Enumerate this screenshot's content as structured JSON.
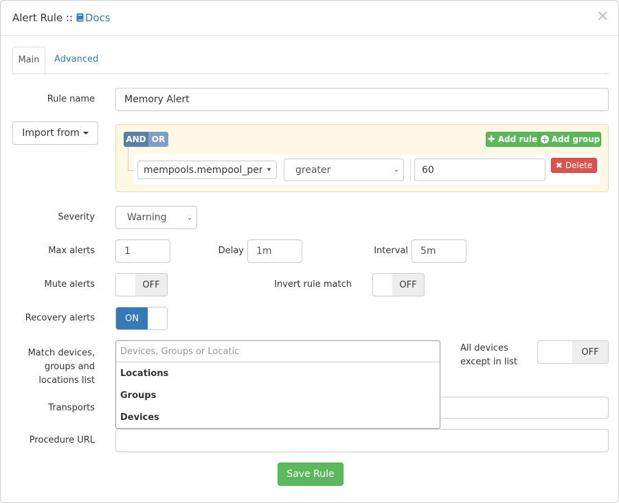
{
  "header": {
    "title": "Alert Rule ::",
    "docs_label": "Docs",
    "close_glyph": "×"
  },
  "tabs": [
    {
      "label": "Main",
      "active": true
    },
    {
      "label": "Advanced",
      "active": false
    }
  ],
  "rule_name": {
    "label": "Rule name",
    "value": "Memory Alert"
  },
  "import_from": {
    "label": "Import from"
  },
  "query_builder": {
    "and_label": "AND",
    "or_label": "OR",
    "selected_condition": "AND",
    "add_rule_label": "Add rule",
    "add_group_label": "Add group",
    "rule": {
      "field": "mempools.mempool_perc",
      "operator": "greater",
      "value": "60",
      "delete_label": "Delete"
    }
  },
  "severity": {
    "label": "Severity",
    "value": "Warning"
  },
  "max_alerts": {
    "label": "Max alerts",
    "value": "1"
  },
  "delay": {
    "label": "Delay",
    "value": "1m"
  },
  "interval": {
    "label": "Interval",
    "value": "5m"
  },
  "mute_alerts": {
    "label": "Mute alerts",
    "state": "OFF"
  },
  "invert_rule_match": {
    "label": "Invert rule match",
    "state": "OFF"
  },
  "recovery_alerts": {
    "label": "Recovery alerts",
    "state": "ON"
  },
  "match_devices": {
    "label_line1": "Match devices,",
    "label_line2": "groups and",
    "label_line3": "locations list",
    "placeholder": "Devices, Groups or Locatic",
    "options": [
      "Locations",
      "Groups",
      "Devices"
    ]
  },
  "all_devices": {
    "label_line1": "All devices",
    "label_line2": "except in list",
    "state": "OFF"
  },
  "transports": {
    "label": "Transports",
    "value": ""
  },
  "procedure_url": {
    "label": "Procedure URL",
    "value": ""
  },
  "save_label": "Save Rule",
  "colors": {
    "primary": "#337ab7",
    "success": "#5cb85c",
    "danger": "#d9534f",
    "builder_bg": "#fcf8e3"
  }
}
